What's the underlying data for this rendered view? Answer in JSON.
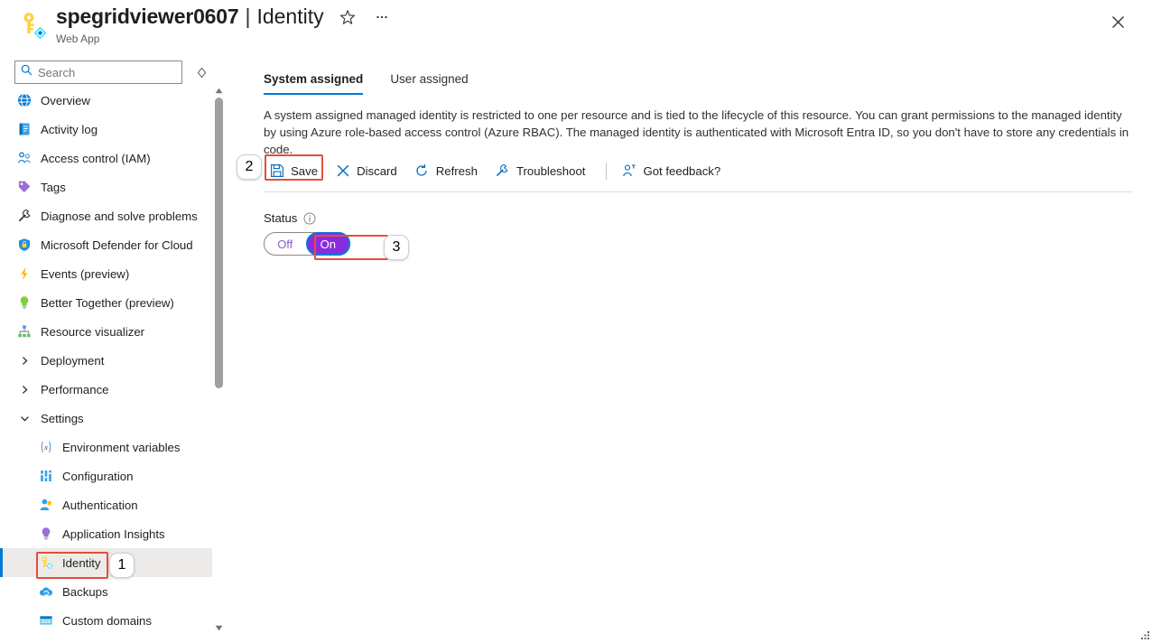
{
  "header": {
    "resource_icon": "key-identity-icon",
    "title": "spegridviewer0607",
    "separator": "|",
    "page": "Identity",
    "subtitle": "Web App",
    "favorite_icon": "star-icon",
    "more_icon": "ellipsis-icon",
    "close_icon": "close-icon"
  },
  "sidebar": {
    "search": {
      "placeholder": "Search",
      "value": "",
      "icon": "search-icon"
    },
    "pin_icon": "pin-icon",
    "collapse_icon": "double-chevron-left-icon",
    "items": [
      {
        "label": "Overview",
        "icon": "overview-icon",
        "type": "item"
      },
      {
        "label": "Activity log",
        "icon": "activity-log-icon",
        "type": "item"
      },
      {
        "label": "Access control (IAM)",
        "icon": "access-control-icon",
        "type": "item"
      },
      {
        "label": "Tags",
        "icon": "tags-icon",
        "type": "item"
      },
      {
        "label": "Diagnose and solve problems",
        "icon": "wrench-icon",
        "type": "item"
      },
      {
        "label": "Microsoft Defender for Cloud",
        "icon": "shield-icon",
        "type": "item"
      },
      {
        "label": "Events (preview)",
        "icon": "lightning-icon",
        "type": "item"
      },
      {
        "label": "Better Together (preview)",
        "icon": "lightbulb-icon",
        "type": "item"
      },
      {
        "label": "Resource visualizer",
        "icon": "resource-visualizer-icon",
        "type": "item"
      },
      {
        "label": "Deployment",
        "icon": "chevron-right-icon",
        "type": "group"
      },
      {
        "label": "Performance",
        "icon": "chevron-right-icon",
        "type": "group"
      },
      {
        "label": "Settings",
        "icon": "chevron-down-icon",
        "type": "group-expanded"
      },
      {
        "label": "Environment variables",
        "icon": "variables-icon",
        "type": "child"
      },
      {
        "label": "Configuration",
        "icon": "configuration-icon",
        "type": "child"
      },
      {
        "label": "Authentication",
        "icon": "authentication-icon",
        "type": "child"
      },
      {
        "label": "Application Insights",
        "icon": "app-insights-icon",
        "type": "child"
      },
      {
        "label": "Identity",
        "icon": "identity-key-icon",
        "type": "child",
        "selected": true
      },
      {
        "label": "Backups",
        "icon": "backups-icon",
        "type": "child"
      },
      {
        "label": "Custom domains",
        "icon": "custom-domains-icon",
        "type": "child"
      }
    ],
    "scrollbar": {
      "up_icon": "scroll-up-arrow",
      "down_icon": "scroll-down-arrow"
    }
  },
  "main": {
    "tabs": [
      {
        "label": "System assigned",
        "active": true
      },
      {
        "label": "User assigned",
        "active": false
      }
    ],
    "description": "A system assigned managed identity is restricted to one per resource and is tied to the lifecycle of this resource. You can grant permissions to the managed identity by using Azure role-based access control (Azure RBAC). The managed identity is authenticated with Microsoft Entra ID, so you don't have to store any credentials in code.",
    "toolbar": [
      {
        "label": "Save",
        "icon": "save-disk-icon"
      },
      {
        "label": "Discard",
        "icon": "discard-x-icon"
      },
      {
        "label": "Refresh",
        "icon": "refresh-icon"
      },
      {
        "label": "Troubleshoot",
        "icon": "wrench-icon"
      },
      {
        "label": "Got feedback?",
        "icon": "feedback-person-icon"
      }
    ],
    "status": {
      "label": "Status",
      "info_icon": "info-circle-icon",
      "options": [
        "Off",
        "On"
      ],
      "selected": "On"
    }
  },
  "annotations": {
    "callouts": [
      {
        "number": "1",
        "target": "sidebar-item-identity"
      },
      {
        "number": "2",
        "target": "save-button"
      },
      {
        "number": "3",
        "target": "status-toggle-on"
      }
    ]
  },
  "colors": {
    "accent": "#0078d4",
    "highlight": "#e74c3c",
    "toggle_on": "#8a2be2",
    "toggle_off_text": "#8764b8",
    "selected_bg": "#edebe9"
  }
}
